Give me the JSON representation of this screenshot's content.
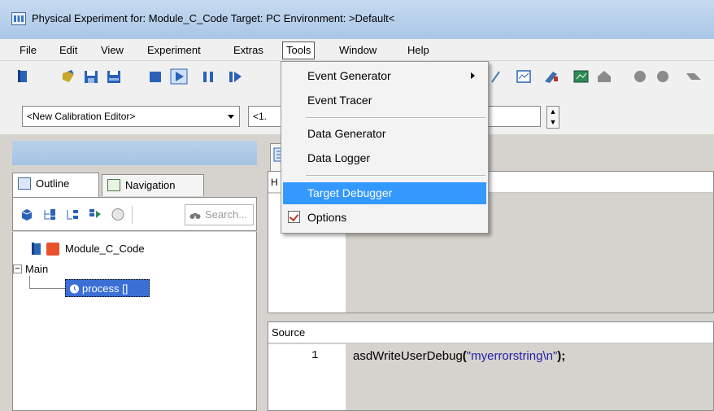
{
  "window": {
    "title": "Physical Experiment for: Module_C_Code  Target: PC  Environment: >Default<"
  },
  "menubar": {
    "items": [
      "File",
      "Edit",
      "View",
      "Experiment",
      "Extras",
      "Tools",
      "Window",
      "Help"
    ],
    "active": "Tools"
  },
  "combo": {
    "calibration_editor": "<New Calibration Editor>",
    "second_partial": "<1."
  },
  "left_panel": {
    "tabs": {
      "outline": "Outline",
      "navigation": "Navigation"
    },
    "search_placeholder": "Search...",
    "tree": {
      "module": "Module_C_Code",
      "group": "Main",
      "expand_glyph": "−",
      "process": "process []"
    }
  },
  "right_panel": {
    "box_header_partial": "H",
    "source_header": "Source",
    "code": {
      "line_number": "1",
      "function": "asdWriteUserDebug",
      "open": "(",
      "string": "\"myerrorstring\\n\"",
      "close": ");"
    }
  },
  "tools_menu": {
    "items": [
      {
        "label": "Event Generator",
        "has_submenu": true
      },
      {
        "label": "Event Tracer"
      },
      {
        "label": "Data Generator"
      },
      {
        "label": "Data Logger"
      },
      {
        "label": "Target Debugger",
        "highlighted": true
      },
      {
        "label": "Options",
        "icon": "checkbox-icon"
      }
    ]
  },
  "colors": {
    "highlight": "#3399ff",
    "titlebar": "#a9c6e6",
    "code_string": "#1f1fa8"
  }
}
